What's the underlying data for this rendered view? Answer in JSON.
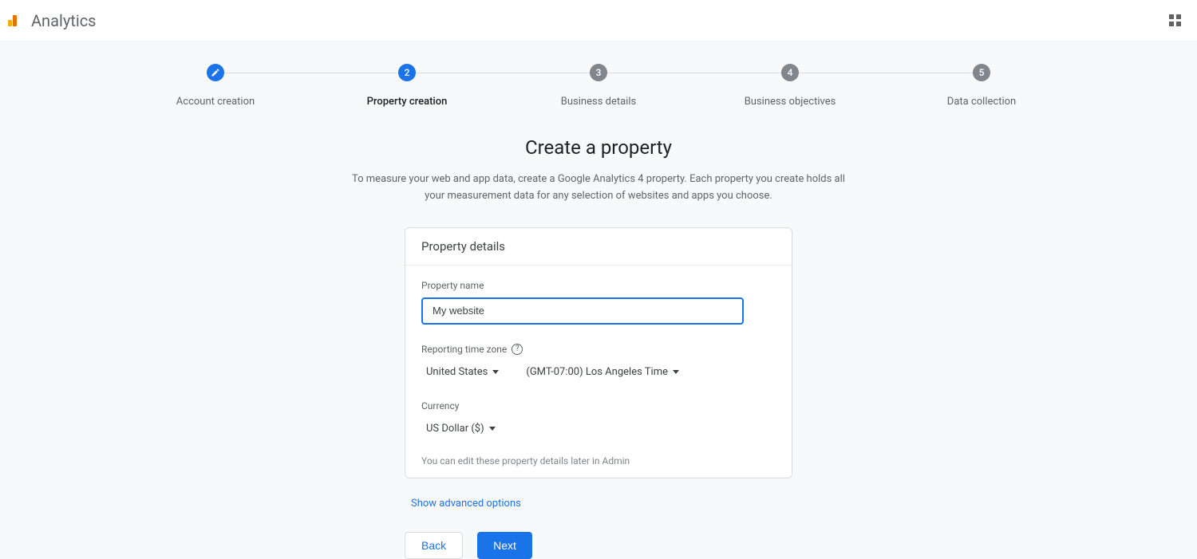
{
  "header": {
    "app_name": "Analytics"
  },
  "stepper": {
    "steps": [
      {
        "label": "Account creation",
        "state": "done"
      },
      {
        "label": "Property creation",
        "state": "active",
        "num": "2"
      },
      {
        "label": "Business details",
        "state": "pending",
        "num": "3"
      },
      {
        "label": "Business objectives",
        "state": "pending",
        "num": "4"
      },
      {
        "label": "Data collection",
        "state": "pending",
        "num": "5"
      }
    ]
  },
  "page": {
    "title": "Create a property",
    "description": "To measure your web and app data, create a Google Analytics 4 property. Each property you create holds all your measurement data for any selection of websites and apps you choose."
  },
  "card": {
    "header": "Property details",
    "property_name_label": "Property name",
    "property_name_value": "My website",
    "timezone_label": "Reporting time zone",
    "timezone_country": "United States",
    "timezone_value": "(GMT-07:00) Los Angeles Time",
    "currency_label": "Currency",
    "currency_value": "US Dollar ($)",
    "hint": "You can edit these property details later in Admin"
  },
  "advanced_link": "Show advanced options",
  "buttons": {
    "back": "Back",
    "next": "Next"
  }
}
